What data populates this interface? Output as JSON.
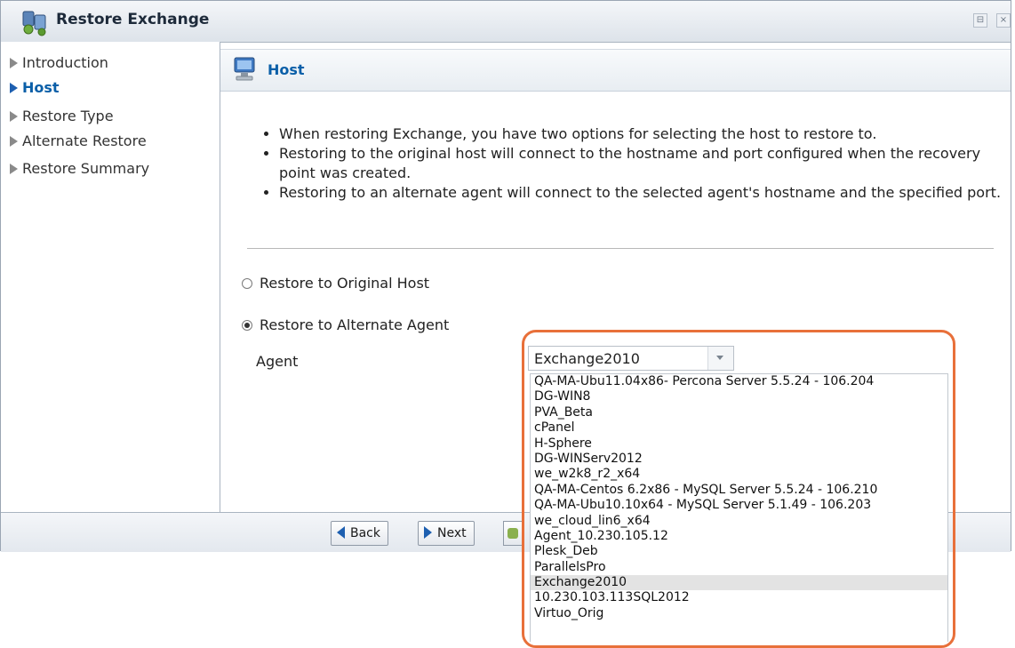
{
  "window": {
    "title": "Restore Exchange",
    "controls": [
      "⊟",
      "×"
    ]
  },
  "sidebar": {
    "items": [
      {
        "label": "Introduction",
        "active": false
      },
      {
        "label": "Host",
        "active": true
      },
      {
        "label": "Restore Type",
        "active": false
      },
      {
        "label": "Alternate Restore",
        "active": false
      },
      {
        "label": "Restore Summary",
        "active": false
      }
    ]
  },
  "section": {
    "title": "Host"
  },
  "info": [
    "When restoring Exchange, you have two options for selecting the host to restore to.",
    "Restoring to the original host will connect to the hostname and port configured when the recovery point was created.",
    "Restoring to an alternate agent will connect to the selected agent's hostname and the specified port."
  ],
  "options": {
    "original_host": {
      "label": "Restore to Original Host",
      "checked": false
    },
    "alternate_agent": {
      "label": "Restore to Alternate Agent",
      "checked": true
    }
  },
  "agent": {
    "label": "Agent",
    "selected": "Exchange2010",
    "options": [
      "QA-MA-Ubu11.04x86- Percona Server 5.5.24 - 106.204",
      "DG-WIN8",
      "PVA_Beta",
      "cPanel",
      "H-Sphere",
      "DG-WINServ2012",
      "we_w2k8_r2_x64",
      "QA-MA-Centos 6.2x86 - MySQL Server 5.5.24 - 106.210",
      "QA-MA-Ubu10.10x64 - MySQL Server 5.1.49 - 106.203",
      "we_cloud_lin6_x64",
      "Agent_10.230.105.12",
      "Plesk_Deb",
      "ParallelsPro",
      "Exchange2010",
      "10.230.103.113SQL2012",
      "Virtuo_Orig"
    ]
  },
  "footer": {
    "back_label": "Back",
    "next_label": "Next"
  },
  "colors": {
    "accent": "#0a5fa8",
    "highlight": "#e8703a",
    "selected_row": "#e3e3e3"
  }
}
